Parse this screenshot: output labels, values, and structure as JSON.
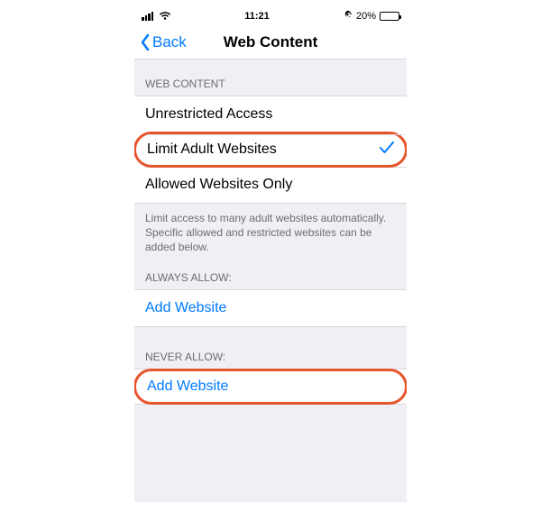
{
  "status": {
    "time": "11:21",
    "battery_pct": "20%"
  },
  "nav": {
    "back_label": "Back",
    "title": "Web Content"
  },
  "sections": {
    "web_content_header": "WEB CONTENT",
    "options": {
      "unrestricted": "Unrestricted Access",
      "limit_adult": "Limit Adult Websites",
      "allowed_only": "Allowed Websites Only",
      "selected_index": 1
    },
    "footer": "Limit access to many adult websites automatically. Specific allowed and restricted websites can be added below.",
    "always_allow_header": "ALWAYS ALLOW:",
    "never_allow_header": "NEVER ALLOW:",
    "add_website_label": "Add Website"
  },
  "colors": {
    "accent": "#007aff",
    "highlight": "#e7552d"
  }
}
